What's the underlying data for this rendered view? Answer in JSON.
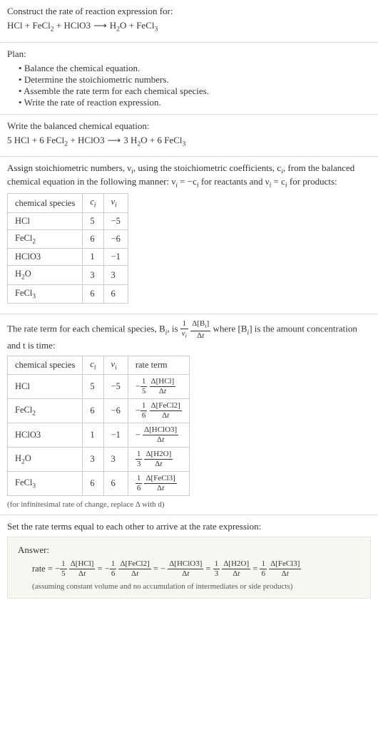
{
  "prompt": {
    "title": "Construct the rate of reaction expression for:",
    "equation": "HCl + FeCl₂ + HClO3 ⟶ H₂O + FeCl₃"
  },
  "plan": {
    "label": "Plan:",
    "items": [
      "Balance the chemical equation.",
      "Determine the stoichiometric numbers.",
      "Assemble the rate term for each chemical species.",
      "Write the rate of reaction expression."
    ]
  },
  "balanced": {
    "intro": "Write the balanced chemical equation:",
    "equation": "5 HCl + 6 FeCl₂ + HClO3 ⟶ 3 H₂O + 6 FeCl₃"
  },
  "stoich": {
    "intro_a": "Assign stoichiometric numbers, ν",
    "intro_b": ", using the stoichiometric coefficients, c",
    "intro_c": ", from the balanced chemical equation in the following manner: ν",
    "intro_d": " = −c",
    "intro_e": " for reactants and ν",
    "intro_f": " = c",
    "intro_g": " for products:",
    "headers": [
      "chemical species",
      "cᵢ",
      "νᵢ"
    ],
    "rows": [
      {
        "species": "HCl",
        "c": "5",
        "v": "−5"
      },
      {
        "species": "FeCl₂",
        "c": "6",
        "v": "−6"
      },
      {
        "species": "HClO3",
        "c": "1",
        "v": "−1"
      },
      {
        "species": "H₂O",
        "c": "3",
        "v": "3"
      },
      {
        "species": "FeCl₃",
        "c": "6",
        "v": "6"
      }
    ]
  },
  "rateterm": {
    "intro_a": "The rate term for each chemical species, B",
    "intro_b": ", is ",
    "intro_c": " where [B",
    "intro_d": "] is the amount concentration and t is time:",
    "headers": [
      "chemical species",
      "cᵢ",
      "νᵢ",
      "rate term"
    ],
    "rows": [
      {
        "species": "HCl",
        "c": "5",
        "v": "−5",
        "sign": "−",
        "coef_num": "1",
        "coef_den": "5",
        "delta": "Δ[HCl]"
      },
      {
        "species": "FeCl₂",
        "c": "6",
        "v": "−6",
        "sign": "−",
        "coef_num": "1",
        "coef_den": "6",
        "delta": "Δ[FeCl2]"
      },
      {
        "species": "HClO3",
        "c": "1",
        "v": "−1",
        "sign": "−",
        "coef_num": "",
        "coef_den": "",
        "delta": "Δ[HClO3]"
      },
      {
        "species": "H₂O",
        "c": "3",
        "v": "3",
        "sign": "",
        "coef_num": "1",
        "coef_den": "3",
        "delta": "Δ[H2O]"
      },
      {
        "species": "FeCl₃",
        "c": "6",
        "v": "6",
        "sign": "",
        "coef_num": "1",
        "coef_den": "6",
        "delta": "Δ[FeCl3]"
      }
    ],
    "note": "(for infinitesimal rate of change, replace Δ with d)"
  },
  "final": {
    "intro": "Set the rate terms equal to each other to arrive at the rate expression:",
    "answer_label": "Answer:",
    "rate_prefix": "rate = ",
    "terms": [
      {
        "sign": "−",
        "num": "1",
        "den": "5",
        "delta": "Δ[HCl]"
      },
      {
        "sign": "−",
        "num": "1",
        "den": "6",
        "delta": "Δ[FeCl2]"
      },
      {
        "sign": "−",
        "num": "",
        "den": "",
        "delta": "Δ[HClO3]"
      },
      {
        "sign": "",
        "num": "1",
        "den": "3",
        "delta": "Δ[H2O]"
      },
      {
        "sign": "",
        "num": "1",
        "den": "6",
        "delta": "Δ[FeCl3]"
      }
    ],
    "note": "(assuming constant volume and no accumulation of intermediates or side products)"
  },
  "chart_data": {
    "type": "table",
    "tables": [
      {
        "title": "Stoichiometric numbers",
        "columns": [
          "chemical species",
          "c_i",
          "ν_i"
        ],
        "rows": [
          [
            "HCl",
            5,
            -5
          ],
          [
            "FeCl2",
            6,
            -6
          ],
          [
            "HClO3",
            1,
            -1
          ],
          [
            "H2O",
            3,
            3
          ],
          [
            "FeCl3",
            6,
            6
          ]
        ]
      },
      {
        "title": "Rate terms",
        "columns": [
          "chemical species",
          "c_i",
          "ν_i",
          "rate term"
        ],
        "rows": [
          [
            "HCl",
            5,
            -5,
            "-(1/5) Δ[HCl]/Δt"
          ],
          [
            "FeCl2",
            6,
            -6,
            "-(1/6) Δ[FeCl2]/Δt"
          ],
          [
            "HClO3",
            1,
            -1,
            "- Δ[HClO3]/Δt"
          ],
          [
            "H2O",
            3,
            3,
            "(1/3) Δ[H2O]/Δt"
          ],
          [
            "FeCl3",
            6,
            6,
            "(1/6) Δ[FeCl3]/Δt"
          ]
        ]
      }
    ]
  }
}
